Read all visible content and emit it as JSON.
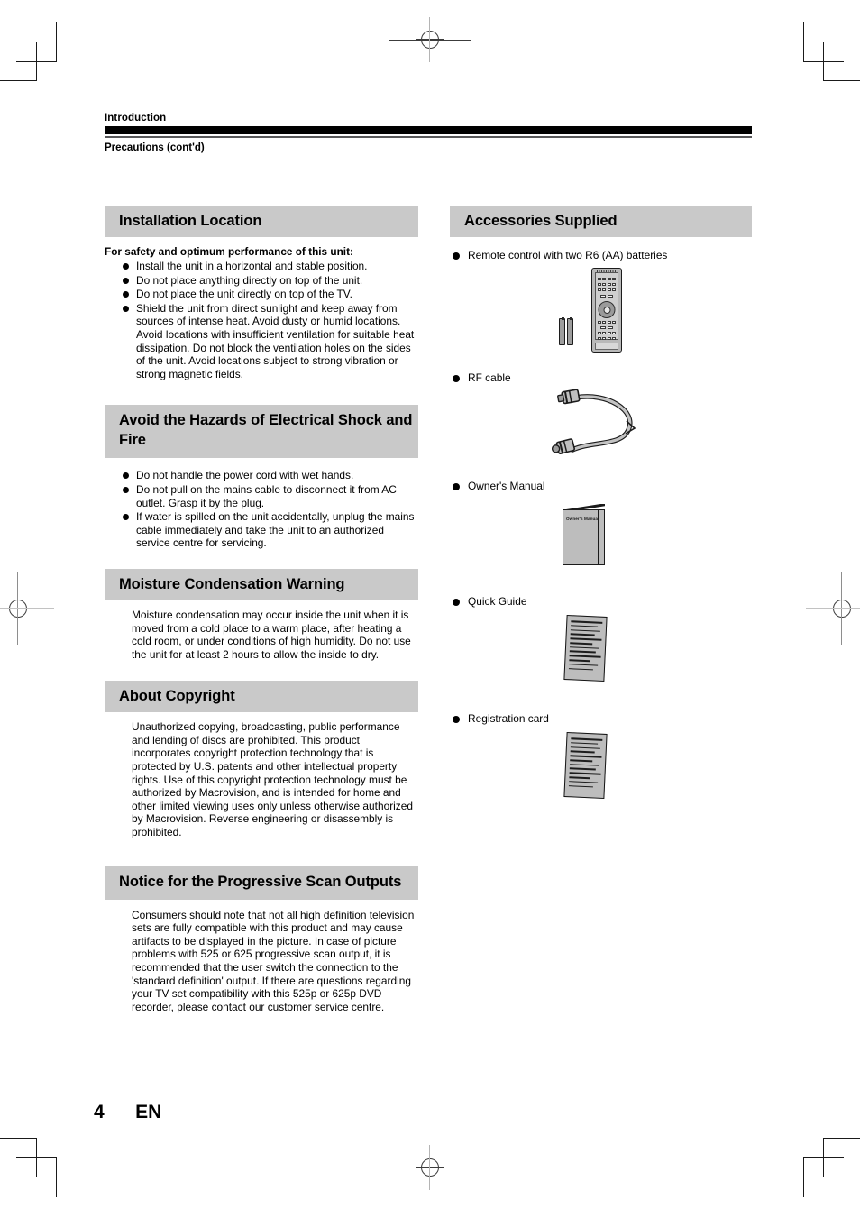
{
  "running_head": {
    "category": "Introduction",
    "subtitle": "Precautions (cont'd)"
  },
  "left_column": {
    "sections": [
      {
        "heading": "Installation Location",
        "lead": "For safety and optimum performance of this unit:",
        "bullets": [
          "Install the unit in a horizontal and stable position.",
          "Do not place anything directly on top of the unit.",
          "Do not place the unit directly on top of the TV.",
          "Shield the unit from direct sunlight and keep away from sources of intense heat. Avoid dusty or humid locations. Avoid locations with insufficient ventilation for suitable heat dissipation. Do not block the ventilation holes on the sides of the unit. Avoid locations subject to strong vibration or strong magnetic fields."
        ]
      },
      {
        "heading": "Avoid the Hazards of Electrical Shock and Fire",
        "bullets": [
          "Do not handle the power cord with wet hands.",
          "Do not pull on the mains cable to disconnect it from AC outlet. Grasp it by the plug.",
          "If water is spilled on the unit accidentally, unplug the mains cable immediately and take the unit to an authorized service centre for servicing."
        ]
      },
      {
        "heading": "Moisture Condensation Warning",
        "paragraph": "Moisture condensation may occur inside the unit when it is moved from a cold place to a warm place, after heating a cold room, or under conditions of high humidity. Do not use the unit for at least 2 hours to allow the inside to dry."
      },
      {
        "heading": "About Copyright",
        "paragraph": "Unauthorized copying, broadcasting, public performance and lending of discs are prohibited. This product incorporates copyright protection technology that is protected by U.S. patents and other intellectual property rights. Use of this copyright protection technology must be authorized by Macrovision, and is intended for home and other limited viewing uses only unless otherwise authorized by Macrovision. Reverse engineering or disassembly is prohibited."
      },
      {
        "heading": "Notice for the Progressive Scan Outputs",
        "paragraph": "Consumers should note that not all high definition television sets are fully compatible with this product and may cause artifacts to be displayed in the picture. In case of picture problems with 525 or 625 progressive scan output, it is recommended that the user switch the connection to the 'standard definition' output. If there are questions regarding your TV set compatibility with this 525p or 625p DVD recorder, please contact our customer service centre."
      }
    ]
  },
  "right_column": {
    "heading": "Accessories Supplied",
    "items": [
      {
        "label": "Remote control with two R6 (AA) batteries",
        "art": "remote-and-batteries"
      },
      {
        "label": "RF cable",
        "art": "rf-cable"
      },
      {
        "label": "Owner's Manual",
        "art": "booklet",
        "cover_title": "Owner's Manual"
      },
      {
        "label": "Quick Guide",
        "art": "sheet"
      },
      {
        "label": "Registration card",
        "art": "sheet"
      }
    ]
  },
  "footer": {
    "page_number": "4",
    "language": "EN"
  },
  "colors": {
    "section_heading_bg": "#c9c9c9",
    "rule_black": "#000000",
    "rule_gray": "#58585a",
    "illustration_fill": "#bdbdbd"
  }
}
